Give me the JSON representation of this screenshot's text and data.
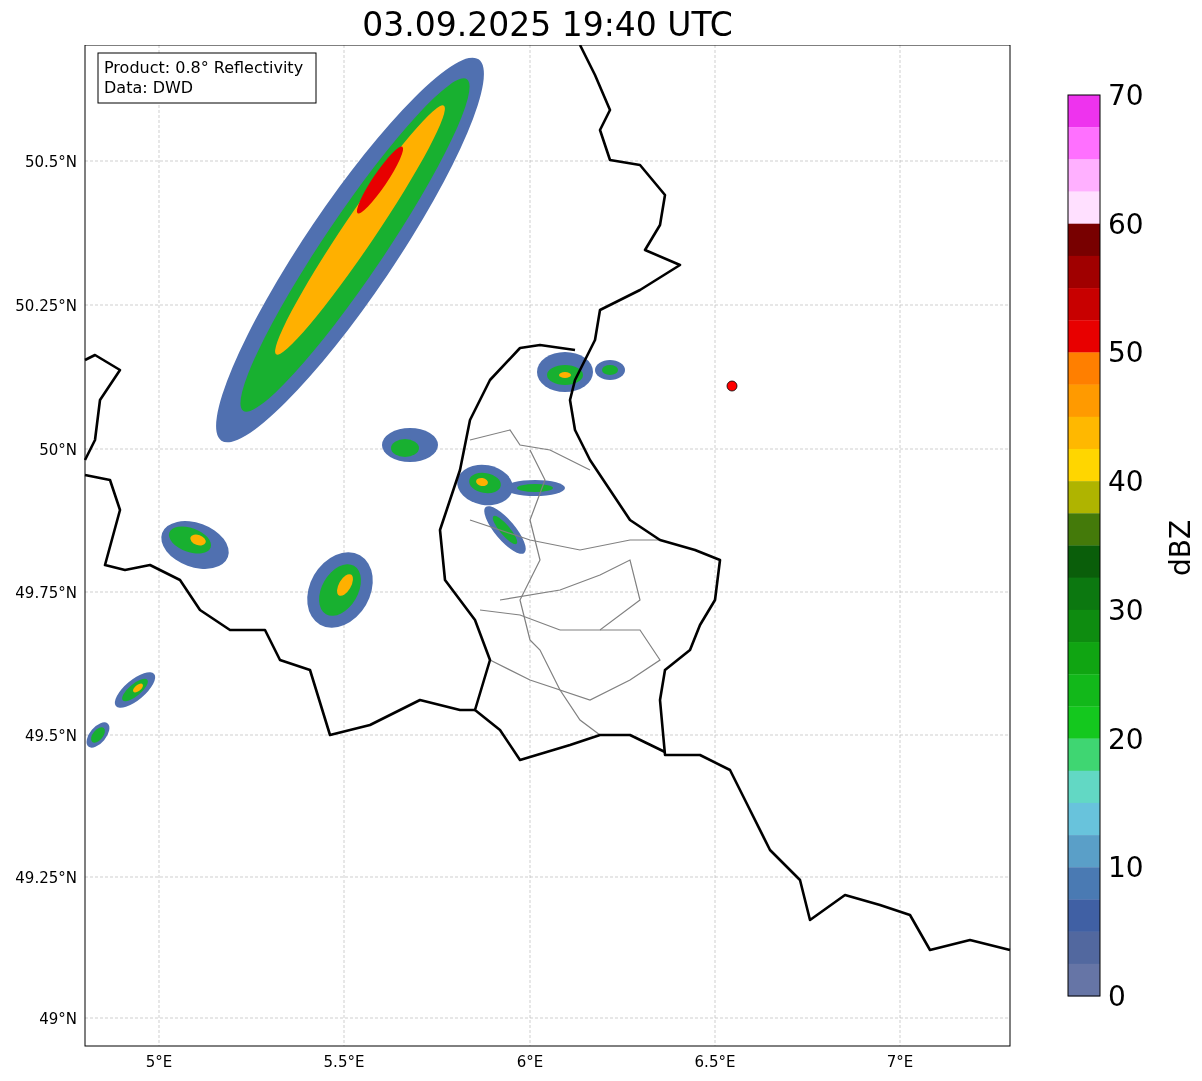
{
  "title": "03.09.2025 19:40 UTC",
  "legend": [
    "Product: 0.8° Reflectivity",
    "Data: DWD"
  ],
  "y_ticks": [
    "50.5°N",
    "50.25°N",
    "50°N",
    "49.75°N",
    "49.5°N",
    "49.25°N",
    "49°N"
  ],
  "x_ticks": [
    "5°E",
    "5.5°E",
    "6°E",
    "6.5°E",
    "7°E"
  ],
  "colorbar": {
    "label": "dBZ",
    "ticks": [
      "70",
      "60",
      "50",
      "40",
      "30",
      "20",
      "10",
      "0"
    ],
    "segments": [
      {
        "color": "#ee33ee"
      },
      {
        "color": "#ff70ff"
      },
      {
        "color": "#ffb0ff"
      },
      {
        "color": "#ffe0ff"
      },
      {
        "color": "#780000"
      },
      {
        "color": "#a00000"
      },
      {
        "color": "#c80000"
      },
      {
        "color": "#e80000"
      },
      {
        "color": "#ff7f00"
      },
      {
        "color": "#ff9a00"
      },
      {
        "color": "#ffb800"
      },
      {
        "color": "#ffd600"
      },
      {
        "color": "#afb400"
      },
      {
        "color": "#447a0a"
      },
      {
        "color": "#0a5e0a"
      },
      {
        "color": "#0c7810"
      },
      {
        "color": "#0e8c10"
      },
      {
        "color": "#10a512"
      },
      {
        "color": "#12b81a"
      },
      {
        "color": "#14c81e"
      },
      {
        "color": "#3fd672"
      },
      {
        "color": "#62d8c4"
      },
      {
        "color": "#68c3dc"
      },
      {
        "color": "#5a9fc8"
      },
      {
        "color": "#4a7ab3"
      },
      {
        "color": "#4060a4"
      },
      {
        "color": "#52689f"
      },
      {
        "color": "#6675a6"
      }
    ]
  }
}
